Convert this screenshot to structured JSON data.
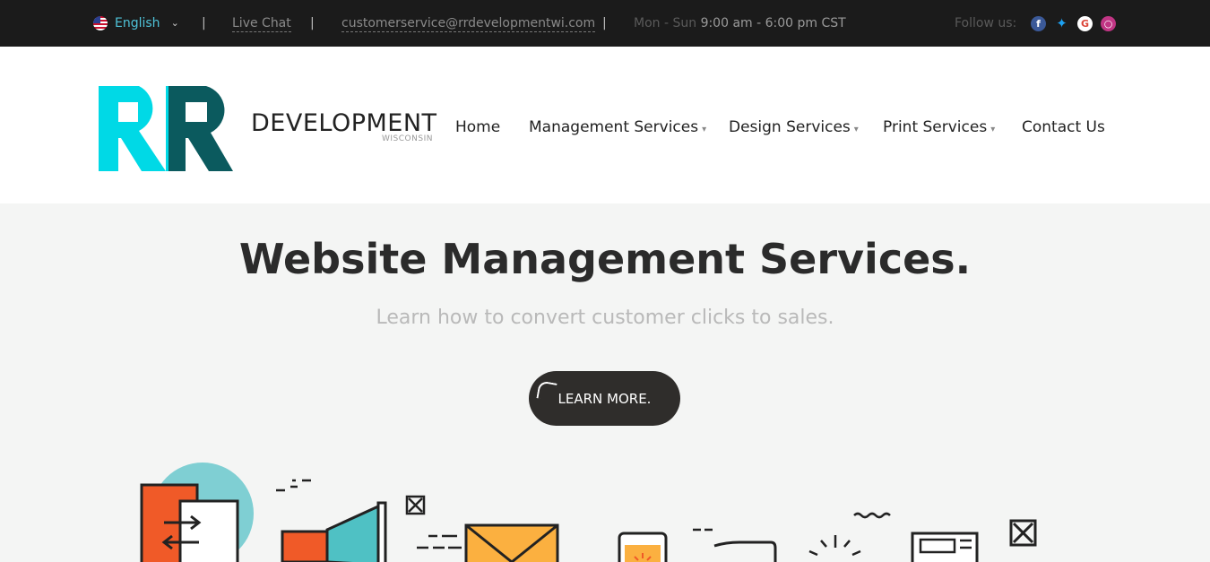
{
  "topbar": {
    "language": "English",
    "separator": "|",
    "live_chat": "Live Chat",
    "email": "customerservice@rrdevelopmentwi.com",
    "hours_label": "Mon - Sun",
    "hours_value": "9:00 am - 6:00 pm CST",
    "follow_label": "Follow us:"
  },
  "header": {
    "brand": "DEVELOPMENT",
    "brand_sub": "WISCONSIN",
    "nav": {
      "home": "Home",
      "management": "Management Services",
      "design": "Design Services",
      "print": "Print Services",
      "contact": "Contact Us"
    }
  },
  "hero": {
    "title": "Website Management Services.",
    "subtitle": "Learn how to convert customer clicks to sales.",
    "cta": "LEARN MORE."
  },
  "icons": {
    "language": "us-flag-icon",
    "facebook": "facebook-icon",
    "twitter": "twitter-icon",
    "google": "google-icon",
    "instagram": "instagram-icon"
  },
  "colors": {
    "topbar_bg": "#1b1b1b",
    "accent_cyan": "#00d9e6",
    "accent_teal": "#0b5a5e",
    "cta_bg": "#2f2d2b",
    "orange": "#f05a28",
    "yellow": "#fbb040"
  }
}
